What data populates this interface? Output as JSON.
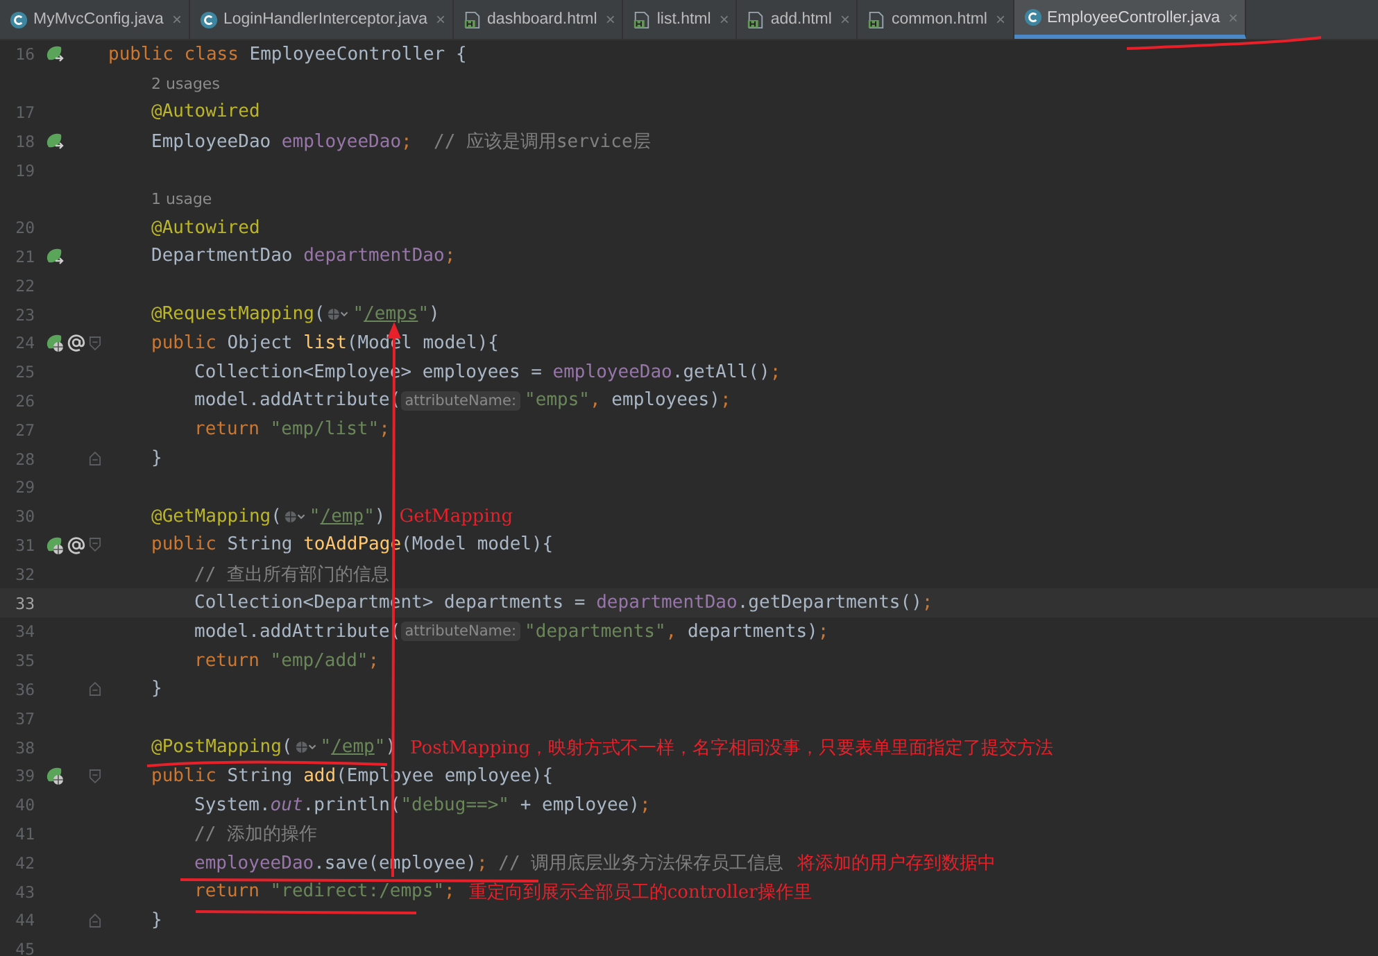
{
  "tabs": [
    {
      "label": "MyMvcConfig.java",
      "kind": "java",
      "close": "×",
      "selected": false
    },
    {
      "label": "LoginHandlerInterceptor.java",
      "kind": "java",
      "close": "×",
      "selected": false
    },
    {
      "label": "dashboard.html",
      "kind": "html",
      "close": "×",
      "selected": false
    },
    {
      "label": "list.html",
      "kind": "html",
      "close": "×",
      "selected": false
    },
    {
      "label": "add.html",
      "kind": "html",
      "close": "×",
      "selected": false
    },
    {
      "label": "common.html",
      "kind": "html",
      "close": "×",
      "selected": false
    },
    {
      "label": "EmployeeController.java",
      "kind": "java",
      "close": "×",
      "selected": true
    }
  ],
  "rows": [
    {
      "kind": "top",
      "number": "16",
      "current": false,
      "gutter": [
        {
          "kind": "bean"
        }
      ],
      "segments": [
        {
          "kind": "code",
          "tokens": [
            {
              "kind": "kw",
              "t": "public class "
            },
            {
              "kind": "plain",
              "t": "EmployeeController {"
            }
          ]
        }
      ]
    },
    {
      "kind": "usage",
      "text": "2 usages"
    },
    {
      "kind": "member",
      "number": "17",
      "current": false,
      "gutter": [],
      "segments": [
        {
          "kind": "code",
          "tokens": [
            {
              "kind": "ann",
              "t": "@Autowired"
            }
          ]
        }
      ]
    },
    {
      "kind": "member",
      "number": "18",
      "current": false,
      "gutter": [
        {
          "kind": "bean"
        }
      ],
      "segments": [
        {
          "kind": "code",
          "tokens": [
            {
              "kind": "plain",
              "t": "EmployeeDao "
            },
            {
              "kind": "field",
              "t": "employeeDao"
            },
            {
              "kind": "kw",
              "t": ";  "
            },
            {
              "kind": "comment",
              "t": "// 应该是调用service层"
            }
          ]
        }
      ]
    },
    {
      "kind": "blank",
      "number": "19",
      "current": false,
      "gutter": [],
      "segments": []
    },
    {
      "kind": "usage",
      "text": "1 usage"
    },
    {
      "kind": "member",
      "number": "20",
      "current": false,
      "gutter": [],
      "segments": [
        {
          "kind": "code",
          "tokens": [
            {
              "kind": "ann",
              "t": "@Autowired"
            }
          ]
        }
      ]
    },
    {
      "kind": "member",
      "number": "21",
      "current": false,
      "gutter": [
        {
          "kind": "bean"
        }
      ],
      "segments": [
        {
          "kind": "code",
          "tokens": [
            {
              "kind": "plain",
              "t": "DepartmentDao "
            },
            {
              "kind": "field",
              "t": "departmentDao"
            },
            {
              "kind": "kw",
              "t": ";"
            }
          ]
        }
      ]
    },
    {
      "kind": "blank",
      "number": "22",
      "current": false,
      "gutter": [],
      "segments": []
    },
    {
      "kind": "member",
      "number": "23",
      "current": false,
      "gutter": [],
      "segments": [
        {
          "kind": "code",
          "tokens": [
            {
              "kind": "ann",
              "t": "@RequestMapping"
            },
            {
              "kind": "plain",
              "t": "("
            }
          ]
        },
        {
          "kind": "icon"
        },
        {
          "kind": "code",
          "tokens": [
            {
              "kind": "str",
              "t": "\""
            },
            {
              "kind": "url",
              "t": "/emps"
            },
            {
              "kind": "str",
              "t": "\""
            },
            {
              "kind": "plain",
              "t": ")"
            }
          ]
        }
      ]
    },
    {
      "kind": "member",
      "number": "24",
      "current": false,
      "gutter": [
        {
          "kind": "web"
        },
        {
          "kind": "at"
        }
      ],
      "fold": {
        "kind": "open"
      },
      "segments": [
        {
          "kind": "code",
          "tokens": [
            {
              "kind": "kw",
              "t": "public "
            },
            {
              "kind": "plain",
              "t": "Object "
            },
            {
              "kind": "method",
              "t": "list"
            },
            {
              "kind": "plain",
              "t": "(Model model){"
            }
          ]
        }
      ]
    },
    {
      "kind": "body",
      "number": "25",
      "current": false,
      "gutter": [],
      "segments": [
        {
          "kind": "code",
          "tokens": [
            {
              "kind": "plain",
              "t": "Collection<Employee> employees = "
            },
            {
              "kind": "field",
              "t": "employeeDao"
            },
            {
              "kind": "plain",
              "t": ".getAll()"
            },
            {
              "kind": "kw",
              "t": ";"
            }
          ]
        }
      ]
    },
    {
      "kind": "body",
      "number": "26",
      "current": false,
      "gutter": [],
      "segments": [
        {
          "kind": "code",
          "tokens": [
            {
              "kind": "plain",
              "t": "model.addAttribute("
            }
          ]
        },
        {
          "kind": "hint",
          "t": "attributeName:"
        },
        {
          "kind": "code",
          "tokens": [
            {
              "kind": "str",
              "t": "\"emps\""
            },
            {
              "kind": "kw",
              "t": ", "
            },
            {
              "kind": "plain",
              "t": "employees)"
            },
            {
              "kind": "kw",
              "t": ";"
            }
          ]
        }
      ]
    },
    {
      "kind": "body",
      "number": "27",
      "current": false,
      "gutter": [],
      "segments": [
        {
          "kind": "code",
          "tokens": [
            {
              "kind": "kw",
              "t": "return "
            },
            {
              "kind": "str",
              "t": "\"emp/list\""
            },
            {
              "kind": "kw",
              "t": ";"
            }
          ]
        }
      ]
    },
    {
      "kind": "member",
      "number": "28",
      "current": false,
      "gutter": [],
      "fold": {
        "kind": "close"
      },
      "segments": [
        {
          "kind": "code",
          "tokens": [
            {
              "kind": "plain",
              "t": "}"
            }
          ]
        }
      ]
    },
    {
      "kind": "blank",
      "number": "29",
      "current": false,
      "gutter": [],
      "segments": []
    },
    {
      "kind": "member",
      "number": "30",
      "current": false,
      "gutter": [],
      "segments": [
        {
          "kind": "code",
          "tokens": [
            {
              "kind": "ann",
              "t": "@GetMapping"
            },
            {
              "kind": "plain",
              "t": "("
            }
          ]
        },
        {
          "kind": "icon"
        },
        {
          "kind": "code",
          "tokens": [
            {
              "kind": "str",
              "t": "\""
            },
            {
              "kind": "url",
              "t": "/emp"
            },
            {
              "kind": "str",
              "t": "\""
            },
            {
              "kind": "plain",
              "t": ")"
            }
          ]
        },
        {
          "kind": "note",
          "t": "GetMapping"
        }
      ]
    },
    {
      "kind": "member",
      "number": "31",
      "current": false,
      "gutter": [
        {
          "kind": "web"
        },
        {
          "kind": "at"
        }
      ],
      "fold": {
        "kind": "open"
      },
      "segments": [
        {
          "kind": "code",
          "tokens": [
            {
              "kind": "kw",
              "t": "public "
            },
            {
              "kind": "plain",
              "t": "String "
            },
            {
              "kind": "method",
              "t": "toAddPage"
            },
            {
              "kind": "plain",
              "t": "(Model model){"
            }
          ]
        }
      ]
    },
    {
      "kind": "body",
      "number": "32",
      "current": false,
      "gutter": [],
      "segments": [
        {
          "kind": "code",
          "tokens": [
            {
              "kind": "comment",
              "t": "// 查出所有部门的信息"
            }
          ]
        }
      ]
    },
    {
      "kind": "body",
      "number": "33",
      "current": true,
      "gutter": [],
      "segments": [
        {
          "kind": "code",
          "tokens": [
            {
              "kind": "plain",
              "t": "Collection<Department> departments = "
            },
            {
              "kind": "field",
              "t": "departmentDao"
            },
            {
              "kind": "plain",
              "t": ".getDepartments()"
            },
            {
              "kind": "kw",
              "t": ";"
            }
          ]
        }
      ]
    },
    {
      "kind": "body",
      "number": "34",
      "current": false,
      "gutter": [],
      "segments": [
        {
          "kind": "code",
          "tokens": [
            {
              "kind": "plain",
              "t": "model.addAttribute("
            }
          ]
        },
        {
          "kind": "hint",
          "t": "attributeName:"
        },
        {
          "kind": "code",
          "tokens": [
            {
              "kind": "str",
              "t": "\"departments\""
            },
            {
              "kind": "kw",
              "t": ", "
            },
            {
              "kind": "plain",
              "t": "departments)"
            },
            {
              "kind": "kw",
              "t": ";"
            }
          ]
        }
      ]
    },
    {
      "kind": "body",
      "number": "35",
      "current": false,
      "gutter": [],
      "segments": [
        {
          "kind": "code",
          "tokens": [
            {
              "kind": "kw",
              "t": "return "
            },
            {
              "kind": "str",
              "t": "\"emp/add\""
            },
            {
              "kind": "kw",
              "t": ";"
            }
          ]
        }
      ]
    },
    {
      "kind": "member",
      "number": "36",
      "current": false,
      "gutter": [],
      "fold": {
        "kind": "close"
      },
      "segments": [
        {
          "kind": "code",
          "tokens": [
            {
              "kind": "plain",
              "t": "}"
            }
          ]
        }
      ]
    },
    {
      "kind": "blank",
      "number": "37",
      "current": false,
      "gutter": [],
      "segments": []
    },
    {
      "kind": "member",
      "number": "38",
      "current": false,
      "gutter": [],
      "segments": [
        {
          "kind": "code",
          "tokens": [
            {
              "kind": "ann",
              "t": "@PostMapping"
            },
            {
              "kind": "plain",
              "t": "("
            }
          ]
        },
        {
          "kind": "icon"
        },
        {
          "kind": "code",
          "tokens": [
            {
              "kind": "str",
              "t": "\""
            },
            {
              "kind": "url",
              "t": "/emp"
            },
            {
              "kind": "str",
              "t": "\""
            },
            {
              "kind": "plain",
              "t": ")"
            }
          ]
        },
        {
          "kind": "note",
          "t": "PostMapping，映射方式不一样，名字相同没事，只要表单里面指定了提交方法"
        }
      ]
    },
    {
      "kind": "member",
      "number": "39",
      "current": false,
      "gutter": [
        {
          "kind": "web"
        }
      ],
      "fold": {
        "kind": "open"
      },
      "segments": [
        {
          "kind": "code",
          "tokens": [
            {
              "kind": "kw",
              "t": "public "
            },
            {
              "kind": "plain",
              "t": "String "
            },
            {
              "kind": "method",
              "t": "add"
            },
            {
              "kind": "plain",
              "t": "(Employee employee){"
            }
          ]
        }
      ]
    },
    {
      "kind": "body",
      "number": "40",
      "current": false,
      "gutter": [],
      "segments": [
        {
          "kind": "code",
          "tokens": [
            {
              "kind": "plain",
              "t": "System."
            },
            {
              "kind": "static",
              "t": "out"
            },
            {
              "kind": "plain",
              "t": ".println("
            },
            {
              "kind": "str",
              "t": "\"debug==>\""
            },
            {
              "kind": "plain",
              "t": " + employee)"
            },
            {
              "kind": "kw",
              "t": ";"
            }
          ]
        }
      ]
    },
    {
      "kind": "body",
      "number": "41",
      "current": false,
      "gutter": [],
      "segments": [
        {
          "kind": "code",
          "tokens": [
            {
              "kind": "comment",
              "t": "// 添加的操作"
            }
          ]
        }
      ]
    },
    {
      "kind": "body",
      "number": "42",
      "current": false,
      "gutter": [],
      "segments": [
        {
          "kind": "code",
          "tokens": [
            {
              "kind": "field",
              "t": "employeeDao"
            },
            {
              "kind": "plain",
              "t": ".save(employee)"
            },
            {
              "kind": "kw",
              "t": "; "
            },
            {
              "kind": "comment",
              "t": "// 调用底层业务方法保存员工信息"
            }
          ]
        },
        {
          "kind": "note",
          "t": "将添加的用户存到数据中"
        }
      ]
    },
    {
      "kind": "body",
      "number": "43",
      "current": false,
      "gutter": [],
      "segments": [
        {
          "kind": "code",
          "tokens": [
            {
              "kind": "kw",
              "t": "return "
            },
            {
              "kind": "str",
              "t": "\"redirect:/emps\""
            },
            {
              "kind": "kw",
              "t": ";"
            }
          ]
        },
        {
          "kind": "note",
          "t": "重定向到展示全部员工的controller操作里"
        }
      ]
    },
    {
      "kind": "member",
      "number": "44",
      "current": false,
      "gutter": [],
      "fold": {
        "kind": "close"
      },
      "segments": [
        {
          "kind": "code",
          "tokens": [
            {
              "kind": "plain",
              "t": "}"
            }
          ]
        }
      ]
    },
    {
      "kind": "blank",
      "number": "45",
      "current": false,
      "gutter": [],
      "segments": []
    }
  ]
}
